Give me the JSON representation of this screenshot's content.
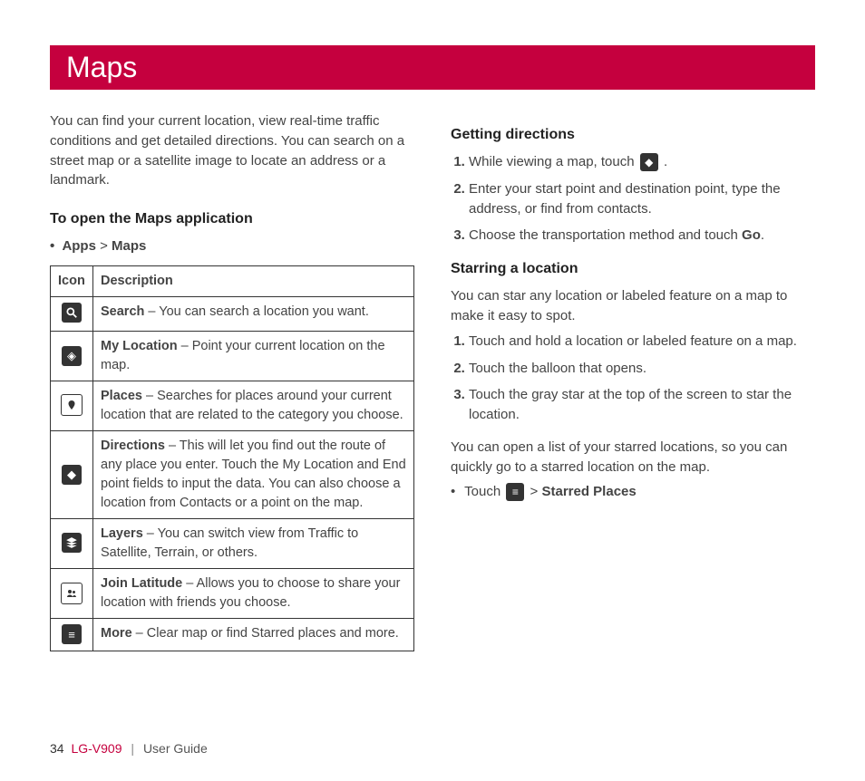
{
  "title": "Maps",
  "intro": "You can find your current location, view real-time traffic conditions and get detailed directions. You can search on a street map or a satellite image to locate an address or a landmark.",
  "openHeading": "To open the Maps application",
  "navPath": {
    "apps": "Apps",
    "sep": ">",
    "maps": "Maps"
  },
  "tableHeader": {
    "icon": "Icon",
    "desc": "Description"
  },
  "rows": {
    "search": {
      "label": "Search",
      "text": " – You can search a location you want."
    },
    "myloc": {
      "label": "My Location",
      "text": " – Point your current location on the map."
    },
    "places": {
      "label": "Places",
      "text": " – Searches for places around your current location that are related to the category you choose."
    },
    "directions": {
      "label": "Directions",
      "text": " – This will let you find out the route of any place you enter. Touch the My Location and End point fields to input the data. You can also choose a location from Contacts or a point on the map."
    },
    "layers": {
      "label": "Layers",
      "text": " – You can switch view from Traffic to Satellite, Terrain, or others."
    },
    "latitude": {
      "label": "Join Latitude",
      "text": " – Allows you to choose to share your location with friends you choose."
    },
    "more": {
      "label": "More",
      "text": " – Clear map or find Starred places and more."
    }
  },
  "directionsSection": {
    "heading": "Getting directions",
    "step1a": "While viewing a map, touch ",
    "step1b": " .",
    "step2": "Enter your start point and destination point, type the address, or find from contacts.",
    "step3a": "Choose the transportation method and touch ",
    "step3b": "Go",
    "step3c": "."
  },
  "starSection": {
    "heading": "Starring a location",
    "intro": "You can star any location or labeled feature on a map to make it easy to spot.",
    "step1": "Touch and hold a location or labeled feature on a map.",
    "step2": "Touch the balloon that opens.",
    "step3": "Touch the gray star at the top of the screen to star the location.",
    "outro": "You can open a list of your starred locations, so you can quickly go to a starred location on the map.",
    "bulletTouch": "Touch ",
    "bulletSep": " > ",
    "bulletStarred": "Starred Places"
  },
  "footer": {
    "page": "34",
    "model": "LG-V909",
    "sep": "|",
    "guide": "User Guide"
  }
}
